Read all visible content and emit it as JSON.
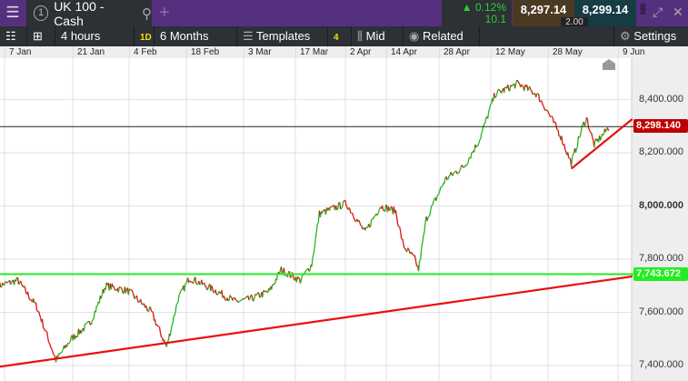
{
  "header": {
    "instrument_number": "1",
    "instrument": "UK 100 - Cash",
    "change_pct": "0.12%",
    "change_pts": "10.1",
    "bid": "8,297.14",
    "ask": "8,299.14",
    "spread": "2.00"
  },
  "toolbar": {
    "interval": "4 hours",
    "interval_badge": "1D",
    "range": "6 Months",
    "templates": "Templates",
    "templates_count": "4",
    "price_type": "Mid",
    "related": "Related",
    "settings": "Settings"
  },
  "date_axis": [
    "7 Jan",
    "21 Jan",
    "4 Feb",
    "18 Feb",
    "3 Mar",
    "17 Mar",
    "2 Apr",
    "14 Apr",
    "28 Apr",
    "12 May",
    "28 May",
    "9 Jun"
  ],
  "price_axis": [
    "8,400.000",
    "8,200.000",
    "8,000.000",
    "7,800.000",
    "7,600.000",
    "7,400.000"
  ],
  "current_price_label": "8,298.140",
  "line_label": "7,743.672",
  "colors": {
    "up": "#1fb81f",
    "down": "#e01010",
    "header": "#55307f",
    "current": "#c00000",
    "hline": "#22ee22"
  },
  "chart_data": {
    "type": "line",
    "x_unit": "days since 7 Jan",
    "ylim": [
      7380,
      8590
    ],
    "points": [
      [
        -7,
        7700
      ],
      [
        -2,
        7720
      ],
      [
        3,
        7620
      ],
      [
        8,
        7420
      ],
      [
        12,
        7500
      ],
      [
        17,
        7560
      ],
      [
        21,
        7700
      ],
      [
        27,
        7680
      ],
      [
        33,
        7600
      ],
      [
        37,
        7470
      ],
      [
        40,
        7650
      ],
      [
        43,
        7730
      ],
      [
        50,
        7680
      ],
      [
        55,
        7640
      ],
      [
        59,
        7650
      ],
      [
        64,
        7680
      ],
      [
        67,
        7760
      ],
      [
        72,
        7720
      ],
      [
        75,
        7780
      ],
      [
        77,
        7970
      ],
      [
        84,
        8010
      ],
      [
        89,
        7900
      ],
      [
        93,
        8000
      ],
      [
        97,
        7980
      ],
      [
        99,
        7850
      ],
      [
        102,
        7800
      ],
      [
        103,
        7760
      ],
      [
        105,
        7950
      ],
      [
        110,
        8100
      ],
      [
        115,
        8150
      ],
      [
        119,
        8250
      ],
      [
        123,
        8420
      ],
      [
        129,
        8460
      ],
      [
        134,
        8420
      ],
      [
        137,
        8350
      ],
      [
        140,
        8270
      ],
      [
        143,
        8160
      ],
      [
        146,
        8300
      ],
      [
        147,
        8330
      ],
      [
        149,
        8230
      ],
      [
        152,
        8280
      ],
      [
        153,
        8300
      ]
    ],
    "current_price": 8298.14,
    "horizontal_line": 7743.672,
    "trendlines": [
      [
        [
          -7,
          7395
        ],
        [
          159,
          7735
        ]
      ],
      [
        [
          143,
          8140
        ],
        [
          159,
          8327
        ]
      ]
    ]
  }
}
